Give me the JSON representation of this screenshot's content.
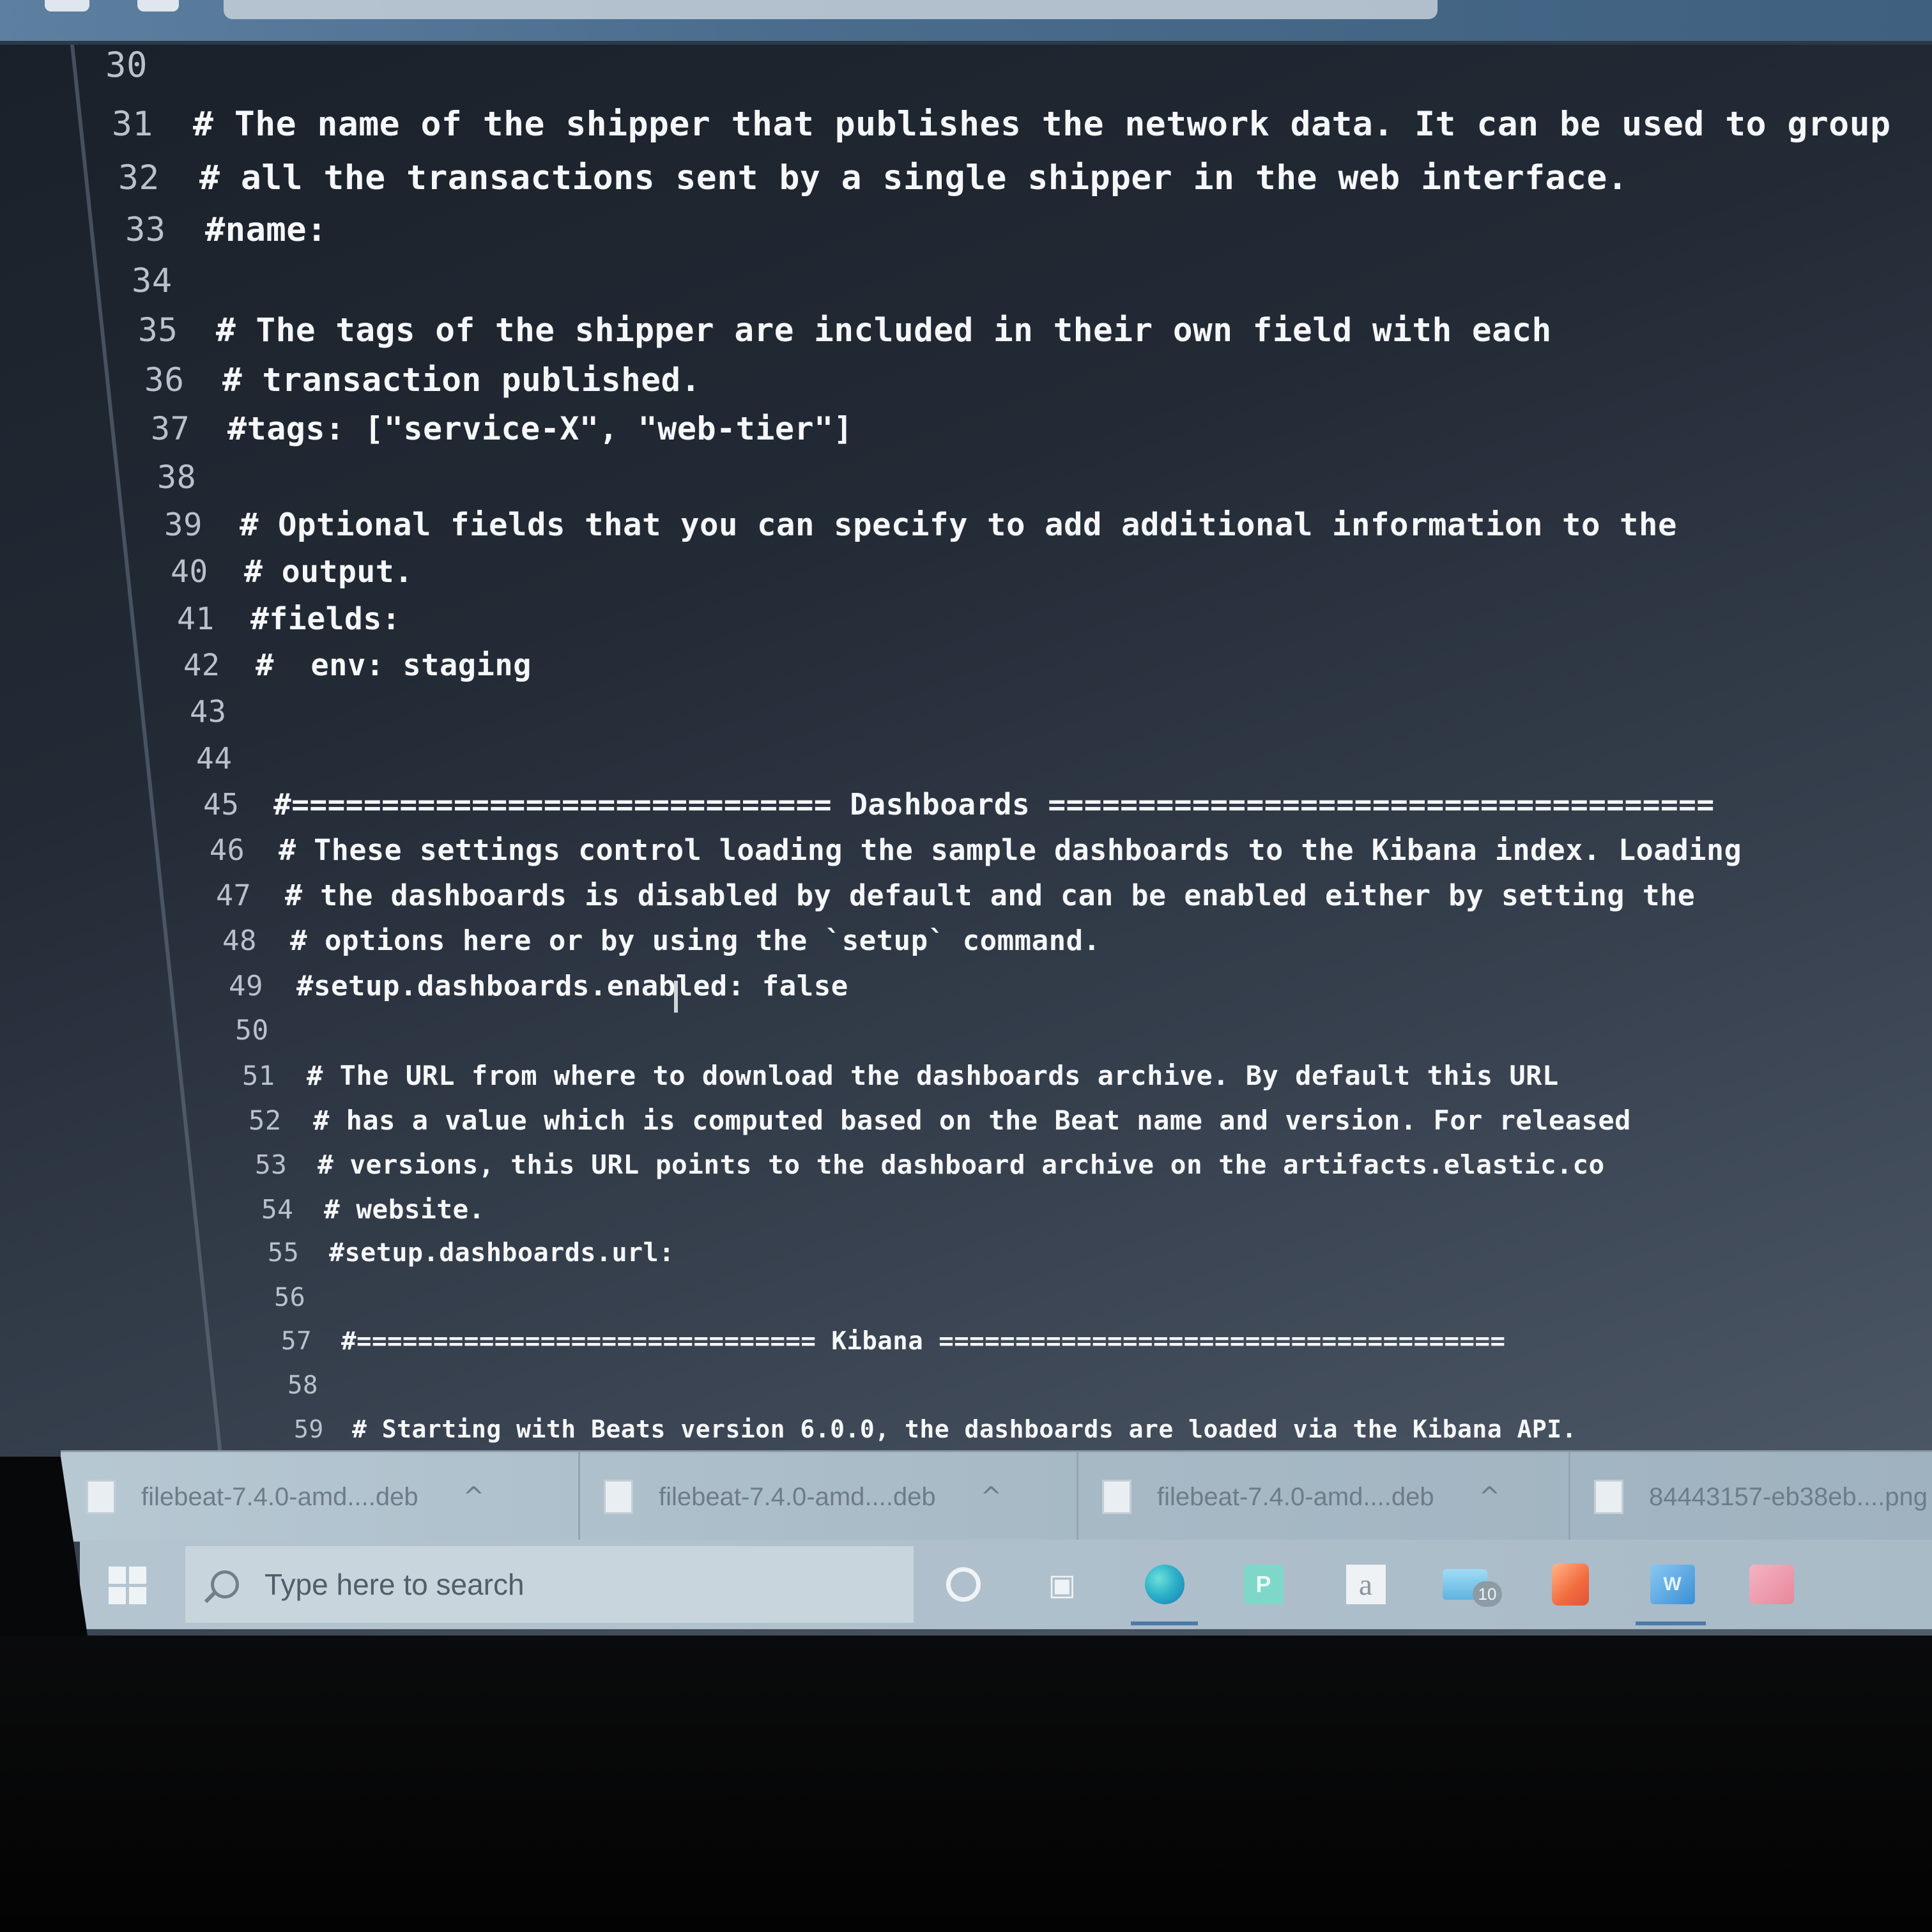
{
  "editor": {
    "lines": [
      {
        "num": "30",
        "text": ""
      },
      {
        "num": "31",
        "text": "# The name of the shipper that publishes the network data. It can be used to group"
      },
      {
        "num": "32",
        "text": "# all the transactions sent by a single shipper in the web interface."
      },
      {
        "num": "33",
        "text": "#name:"
      },
      {
        "num": "34",
        "text": ""
      },
      {
        "num": "35",
        "text": "# The tags of the shipper are included in their own field with each"
      },
      {
        "num": "36",
        "text": "# transaction published."
      },
      {
        "num": "37",
        "text": "#tags: [\"service-X\", \"web-tier\"]"
      },
      {
        "num": "38",
        "text": ""
      },
      {
        "num": "39",
        "text": "# Optional fields that you can specify to add additional information to the"
      },
      {
        "num": "40",
        "text": "# output."
      },
      {
        "num": "41",
        "text": "#fields:"
      },
      {
        "num": "42",
        "text": "#  env: staging"
      },
      {
        "num": "43",
        "text": ""
      },
      {
        "num": "44",
        "text": ""
      },
      {
        "num": "45",
        "text": "#============================== Dashboards ====================================="
      },
      {
        "num": "46",
        "text": "# These settings control loading the sample dashboards to the Kibana index. Loading"
      },
      {
        "num": "47",
        "text": "# the dashboards is disabled by default and can be enabled either by setting the"
      },
      {
        "num": "48",
        "text": "# options here or by using the `setup` command."
      },
      {
        "num": "49",
        "text": "#setup.dashboards.enabled: false"
      },
      {
        "num": "50",
        "text": ""
      },
      {
        "num": "51",
        "text": "# The URL from where to download the dashboards archive. By default this URL"
      },
      {
        "num": "52",
        "text": "# has a value which is computed based on the Beat name and version. For released"
      },
      {
        "num": "53",
        "text": "# versions, this URL points to the dashboard archive on the artifacts.elastic.co"
      },
      {
        "num": "54",
        "text": "# website."
      },
      {
        "num": "55",
        "text": "#setup.dashboards.url:"
      },
      {
        "num": "56",
        "text": ""
      },
      {
        "num": "57",
        "text": "#============================== Kibana ====================================="
      },
      {
        "num": "58",
        "text": ""
      },
      {
        "num": "59",
        "text": "# Starting with Beats version 6.0.0, the dashboards are loaded via the Kibana API."
      }
    ]
  },
  "downloads": {
    "items": [
      {
        "name": "filebeat-7.4.0-amd....deb",
        "chevron": "^"
      },
      {
        "name": "filebeat-7.4.0-amd....deb",
        "chevron": "^"
      },
      {
        "name": "filebeat-7.4.0-amd....deb",
        "chevron": "^"
      },
      {
        "name": "84443157-eb38eb....png",
        "chevron": ""
      }
    ]
  },
  "taskbar": {
    "search_placeholder": "Type here to search",
    "mail_badge": "10",
    "icons": [
      "windows-start-icon",
      "search-icon",
      "cortana-icon",
      "task-view-icon",
      "edge-icon",
      "publisher-icon",
      "amazon-icon",
      "mail-icon",
      "office-icon",
      "word-icon",
      "photos-icon"
    ],
    "pub_letter": "P",
    "amazon_letter": "a",
    "word_letter": "W"
  }
}
